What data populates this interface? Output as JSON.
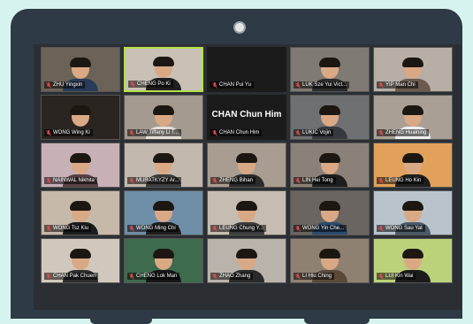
{
  "participants": [
    {
      "name": "ZHU Yingxin",
      "bg": "#6b6258",
      "shirt": "#2a3b5a",
      "active": false
    },
    {
      "name": "CHENG Po Ki",
      "bg": "#c9c1b5",
      "shirt": "#1f1f1f",
      "active": true
    },
    {
      "name": "CHAN Pui Yu",
      "bg": "#1b1b1b",
      "shirt": "#1b1b1b",
      "active": false,
      "dark": true
    },
    {
      "name": "LUK Sze Yui Vict...",
      "bg": "#7f7a74",
      "shirt": "#2c2c2c",
      "active": false
    },
    {
      "name": "YIP Man Chi",
      "bg": "#b7aea6",
      "shirt": "#6b5a4d",
      "active": false
    },
    {
      "name": "WONG Wing Ki",
      "bg": "#2a2520",
      "shirt": "#2a2520",
      "active": false
    },
    {
      "name": "LAW Tiffany Li T...",
      "bg": "#a59a8f",
      "shirt": "#e6e0d8",
      "active": false
    },
    {
      "name": "CHAN Chun Him",
      "bg": "#1b1b1b",
      "shirt": "#1b1b1b",
      "active": false,
      "dark": true,
      "big": true
    },
    {
      "name": "LUKIC Vojin",
      "bg": "#6f7072",
      "shirt": "#36393d",
      "active": false
    },
    {
      "name": "ZHENG Hualning",
      "bg": "#a99f94",
      "shirt": "#eeeeee",
      "active": false
    },
    {
      "name": "NAINWAL Nikhita",
      "bg": "#c7b0b6",
      "shirt": "#5c3f44",
      "active": false
    },
    {
      "name": "MURATKYZY Ar...",
      "bg": "#c3b8ad",
      "shirt": "#3e3c3a",
      "active": false
    },
    {
      "name": "ZHENG Bihan",
      "bg": "#a89d90",
      "shirt": "#2b2b2b",
      "active": false
    },
    {
      "name": "LIN Hei Tong",
      "bg": "#8a8278",
      "shirt": "#1e1e1e",
      "active": false
    },
    {
      "name": "LEUNG Ho Kin",
      "bg": "#e1a15b",
      "shirt": "#1e1e1e",
      "active": false
    },
    {
      "name": "WONG Tsz Kiu",
      "bg": "#c6b9a9",
      "shirt": "#1c1c1c",
      "active": false
    },
    {
      "name": "WONG Ming Chi",
      "bg": "#6f8ea7",
      "shirt": "#1e1e1e",
      "active": false
    },
    {
      "name": "LEUNG Chung Y...",
      "bg": "#c5bdb2",
      "shirt": "#3b3b3b",
      "active": false
    },
    {
      "name": "WONG Yin Che...",
      "bg": "#6a6560",
      "shirt": "#2d4b6e",
      "active": false
    },
    {
      "name": "WONG Sau Yat",
      "bg": "#b9c3cb",
      "shirt": "#4c5a68",
      "active": false
    },
    {
      "name": "CHAN Pak Chuen",
      "bg": "#d1c8bd",
      "shirt": "#2d2d2d",
      "active": false
    },
    {
      "name": "CHENG Lok Man",
      "bg": "#3e6b4d",
      "shirt": "#161616",
      "active": false
    },
    {
      "name": "ZHAO Zhang",
      "bg": "#b9b3ab",
      "shirt": "#2a2a2a",
      "active": false
    },
    {
      "name": "LI Hiu Ching",
      "bg": "#8f8172",
      "shirt": "#5b4a3a",
      "active": false
    },
    {
      "name": "LUI Kin Wai",
      "bg": "#bcd27a",
      "shirt": "#1b1b1b",
      "active": false
    }
  ],
  "colors": {
    "background": "#d7f3ef",
    "frame": "#2e3a46",
    "active_border": "#b6e04a",
    "mic_muted": "#e04a4a"
  },
  "icons": {
    "tile_label": "microphone-muted-icon",
    "camera": "camera-dot-icon"
  }
}
